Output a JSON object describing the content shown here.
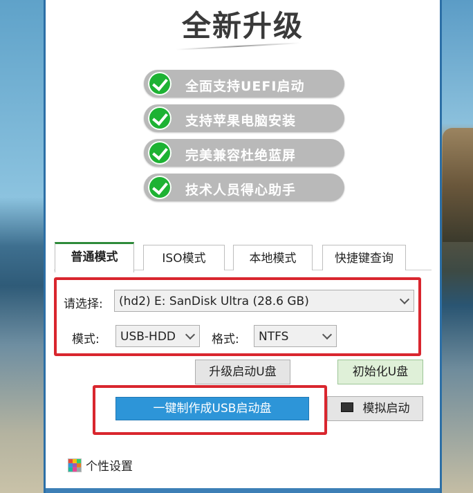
{
  "header": {
    "title": "全新升级"
  },
  "features": [
    {
      "label": "全面支持UEFI启动",
      "icon": "check-icon"
    },
    {
      "label": "支持苹果电脑安装",
      "icon": "check-icon"
    },
    {
      "label": "完美兼容杜绝蓝屏",
      "icon": "check-icon"
    },
    {
      "label": "技术人员得心助手",
      "icon": "check-icon"
    }
  ],
  "tabs": [
    {
      "label": "普通模式",
      "active": true
    },
    {
      "label": "ISO模式",
      "active": false
    },
    {
      "label": "本地模式",
      "active": false
    },
    {
      "label": "快捷键查询",
      "active": false
    }
  ],
  "form": {
    "select_label": "请选择:",
    "device_value": "(hd2) E: SanDisk Ultra (28.6 GB)",
    "mode_label": "模式:",
    "mode_value": "USB-HDD",
    "format_label": "格式:",
    "format_value": "NTFS"
  },
  "buttons": {
    "upgrade": "升级启动U盘",
    "init": "初始化U盘",
    "make": "一键制作成USB启动盘",
    "simulate": "模拟启动"
  },
  "footer": {
    "settings_label": "个性设置"
  },
  "colors": {
    "accent_blue": "#2d95d8",
    "check_green": "#1db233",
    "highlight_red": "#d9262e",
    "tab_active_green": "#2e8b3a"
  }
}
